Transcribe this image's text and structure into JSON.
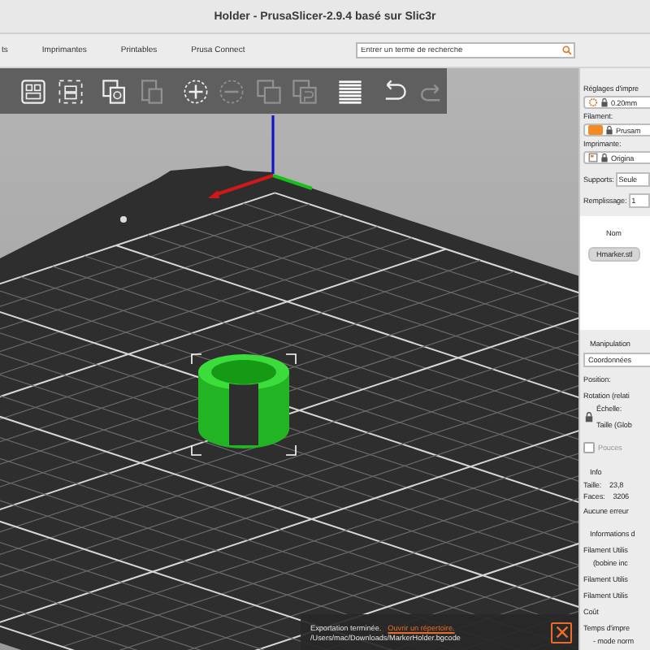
{
  "window": {
    "title": "Holder - PrusaSlicer-2.9.4 basé sur Slic3r"
  },
  "tabs": [
    {
      "label": "ts",
      "selected": false
    },
    {
      "label": "Imprimantes",
      "selected": false
    },
    {
      "label": "Printables",
      "selected": false
    },
    {
      "label": "Prusa Connect",
      "selected": false
    }
  ],
  "search": {
    "placeholder": "Entrer un terme de recherche"
  },
  "toolbar": [
    {
      "kind": "arrange",
      "disabled": false
    },
    {
      "kind": "select",
      "disabled": false
    },
    {
      "kind": "copy",
      "disabled": false
    },
    {
      "kind": "paste",
      "disabled": true
    },
    {
      "kind": "add",
      "disabled": false
    },
    {
      "kind": "remove",
      "disabled": true
    },
    {
      "kind": "split-objects",
      "disabled": true
    },
    {
      "kind": "split-parts",
      "disabled": true
    },
    {
      "kind": "layers",
      "disabled": false
    },
    {
      "kind": "undo",
      "disabled": false
    },
    {
      "kind": "redo",
      "disabled": true
    }
  ],
  "sidebar": [
    {
      "kind": "heading",
      "text": "Réglages d'impre"
    },
    {
      "kind": "print-preset",
      "value": "0.20mm"
    },
    {
      "kind": "heading",
      "text": "Filament:"
    },
    {
      "kind": "filament-preset",
      "value": "Prusam",
      "color": "#f08a24"
    },
    {
      "kind": "heading",
      "text": "Imprimante:"
    },
    {
      "kind": "printer-preset",
      "value": "Origina"
    },
    {
      "kind": "field",
      "label": "Supports:",
      "value": "Seule"
    },
    {
      "kind": "field",
      "label": "Remplissage:",
      "value": "1"
    },
    {
      "kind": "list",
      "header": "Nom",
      "items": [
        {
          "name": "Hmarker.stl",
          "selected": true
        }
      ]
    },
    {
      "kind": "section",
      "text": "Manipulation"
    },
    {
      "kind": "dropdown",
      "value": "Coordonnées"
    },
    {
      "kind": "text",
      "text": "Position:"
    },
    {
      "kind": "text",
      "text": "Rotation (relati"
    },
    {
      "kind": "scale",
      "lines": [
        "Échelle:",
        "Taille (Glob"
      ]
    },
    {
      "kind": "checkbox",
      "label": "Pouces",
      "checked": false
    },
    {
      "kind": "section",
      "text": "Info"
    },
    {
      "kind": "pair",
      "label": "Taille:",
      "value": "23,8"
    },
    {
      "kind": "pair",
      "label": "Faces:",
      "value": "3206"
    },
    {
      "kind": "text",
      "text": "Aucune erreur"
    },
    {
      "kind": "section",
      "text": "Informations d"
    },
    {
      "kind": "text",
      "text": "Filament Utilis"
    },
    {
      "kind": "subtext",
      "text": "(bobine inc"
    },
    {
      "kind": "text",
      "text": "Filament Utilis"
    },
    {
      "kind": "text",
      "text": "Filament Utilis"
    },
    {
      "kind": "text",
      "text": "Coût"
    },
    {
      "kind": "text",
      "text": "Temps d'impre"
    },
    {
      "kind": "subtext",
      "text": "- mode norm"
    }
  ],
  "notification": {
    "message": "Exportation terminée.",
    "link": "Ouvrir un répertoire.",
    "path": "/Users/mac/Downloads/MarkerHolder.bgcode"
  }
}
